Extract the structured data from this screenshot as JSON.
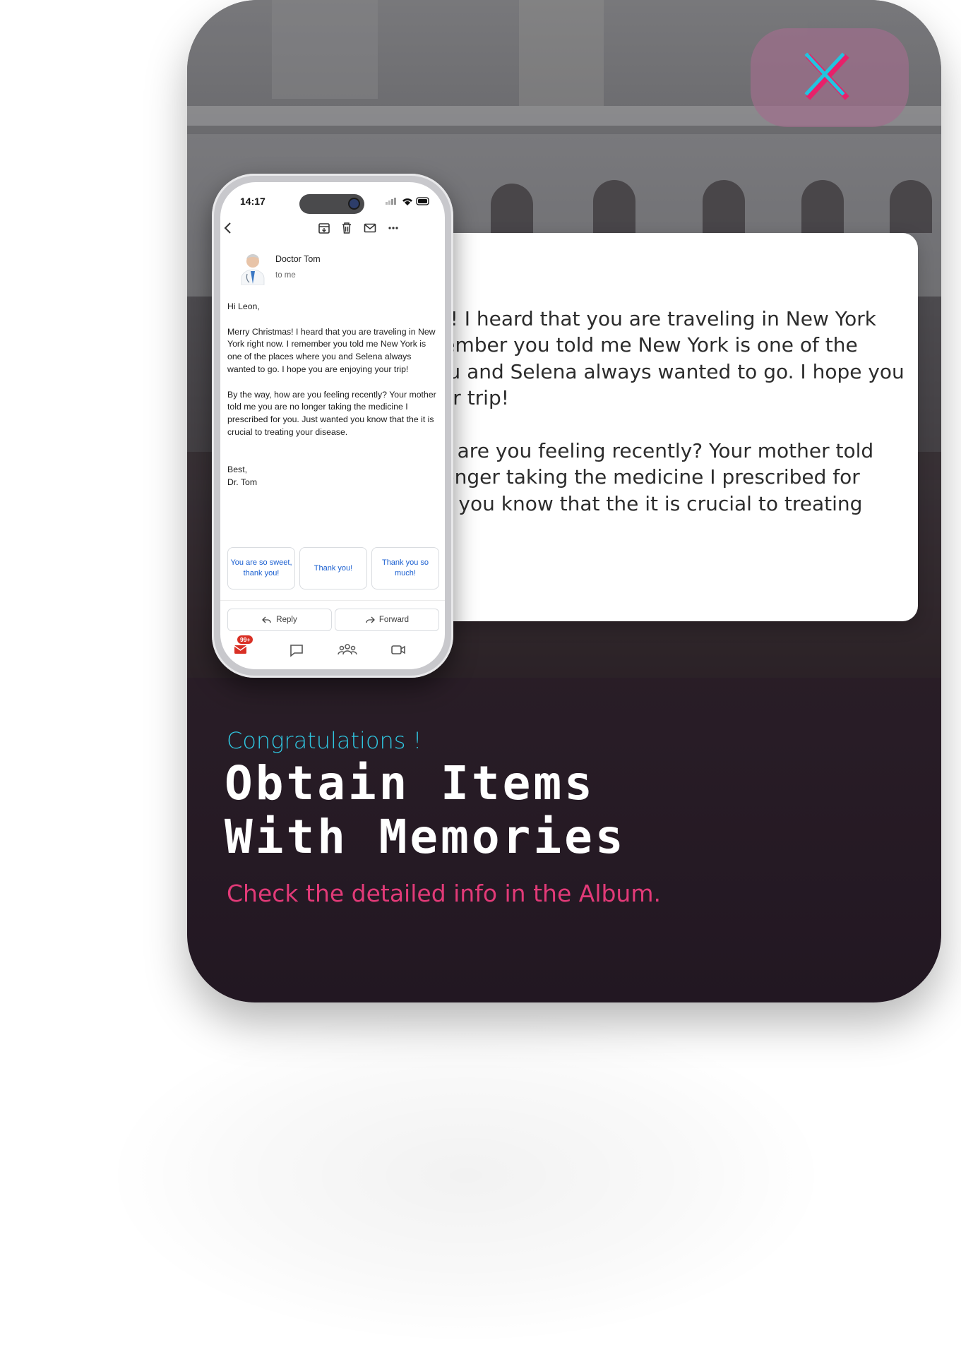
{
  "phone": {
    "status_time": "14:17",
    "sender_name": "Doctor Tom",
    "sender_to": "to me",
    "email_body": [
      "Hi Leon,",
      "Merry Christmas! I heard that you are traveling in New York right now. I remember you told me New York is one of the places where you and Selena always wanted to go. I hope you are enjoying your trip!",
      "By the way, how are you feeling recently? Your mother told me you are no longer taking the medicine I prescribed for you. Just wanted you know that the it is crucial to treating your disease.",
      "Best,"
    ],
    "signature": "Dr. Tom",
    "smart_replies": [
      "You are so sweet, thank you!",
      "Thank you!",
      "Thank you so much!"
    ],
    "reply_label": "Reply",
    "forward_label": "Forward",
    "mail_badge": "99+"
  },
  "zoom_email": {
    "paragraphs": [
      "Hi Leon,",
      "Merry Christmas! I heard that you are traveling in New York right now. I remember you told me New York is one of the places where you and Selena always wanted to go. I hope you are enjoying your trip!",
      "By the way, how are you feeling recently? Your mother told me you are no longer taking the medicine I prescribed for you. Just wanted you know that the it is crucial to treating your disease."
    ]
  },
  "reward": {
    "congrats": "Congratulations !",
    "title_line1": "Obtain Items",
    "title_line2": "With Memories",
    "subtitle": "Check the detailed info in the Album."
  },
  "colors": {
    "congrats": "#2fc6e0",
    "subtitle": "#e23a78",
    "close_x_cyan": "#22c4df",
    "close_x_pink": "#e8216a",
    "chip_text": "#1a5fd0",
    "badge": "#d93025"
  },
  "icons": [
    "close-icon",
    "back-icon",
    "archive-icon",
    "delete-icon",
    "mail-icon",
    "more-icon",
    "reply-icon",
    "forward-icon",
    "mail-nav-icon",
    "chat-icon",
    "spaces-icon",
    "meet-icon"
  ]
}
